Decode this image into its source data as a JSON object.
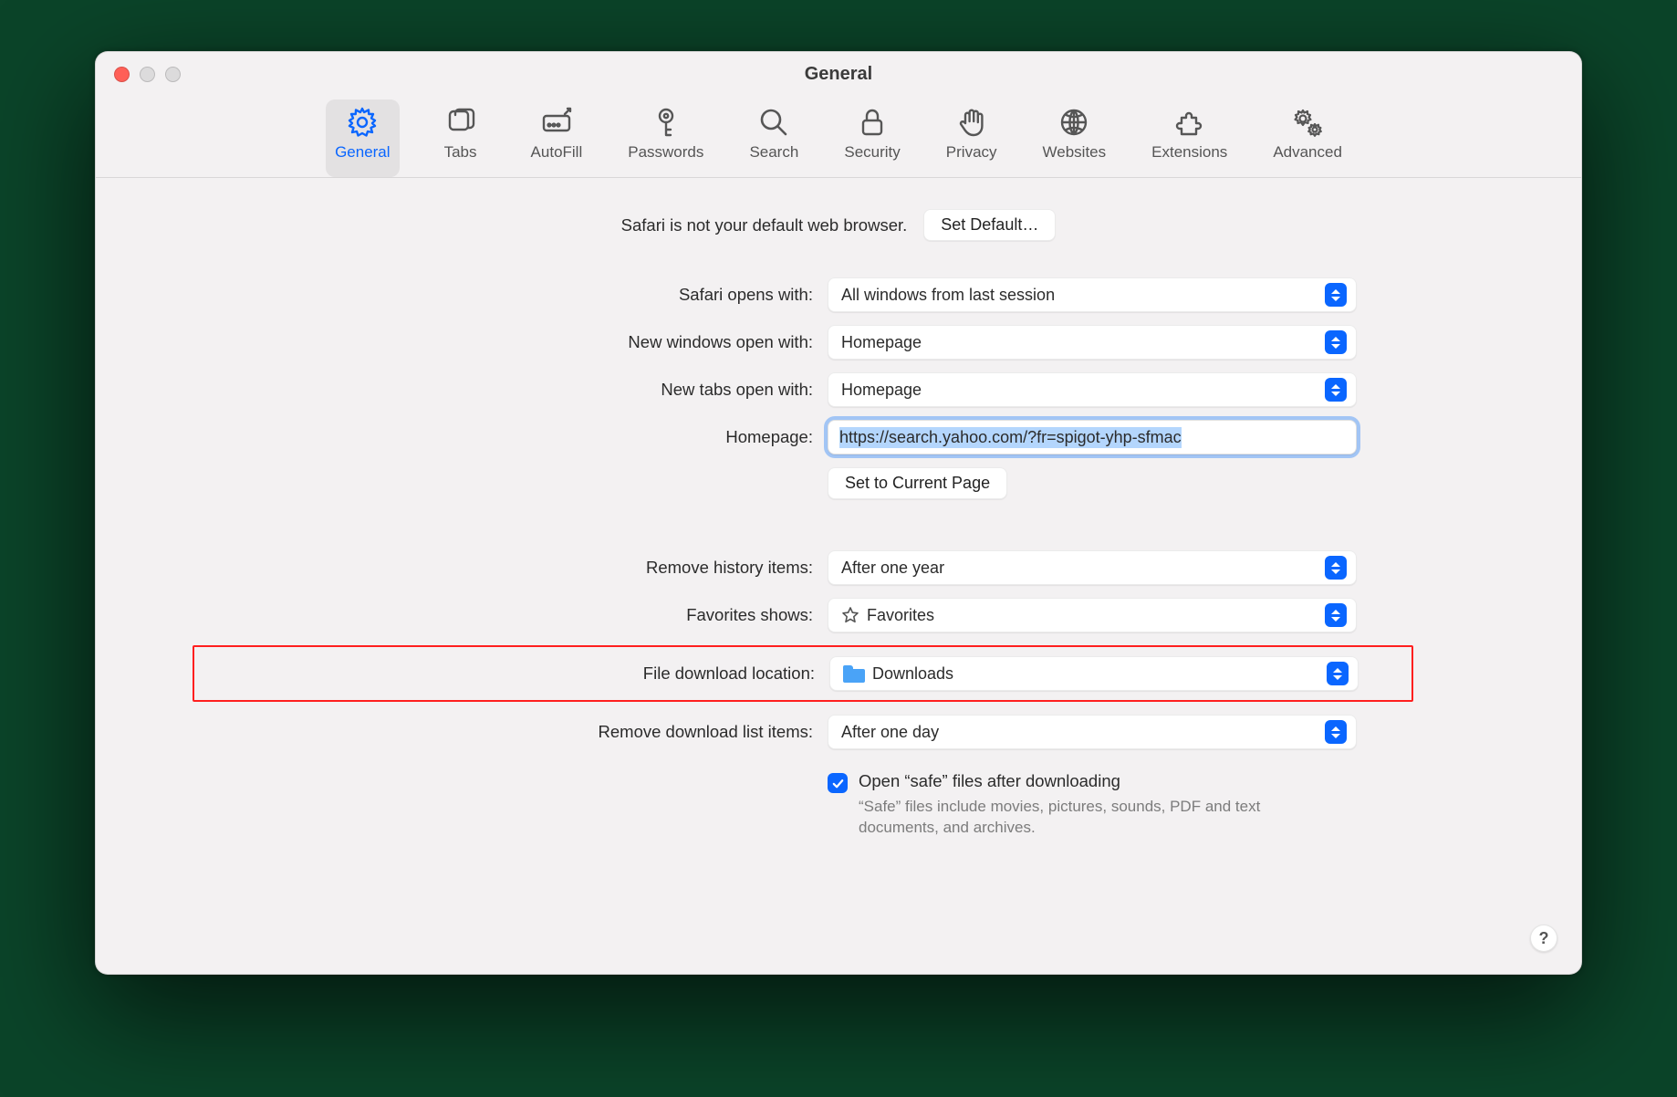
{
  "window": {
    "title": "General"
  },
  "toolbar": {
    "items": [
      {
        "label": "General"
      },
      {
        "label": "Tabs"
      },
      {
        "label": "AutoFill"
      },
      {
        "label": "Passwords"
      },
      {
        "label": "Search"
      },
      {
        "label": "Security"
      },
      {
        "label": "Privacy"
      },
      {
        "label": "Websites"
      },
      {
        "label": "Extensions"
      },
      {
        "label": "Advanced"
      }
    ]
  },
  "default_browser": {
    "message": "Safari is not your default web browser.",
    "button": "Set Default…"
  },
  "rows": {
    "opens_with": {
      "label": "Safari opens with:",
      "value": "All windows from last session"
    },
    "new_windows": {
      "label": "New windows open with:",
      "value": "Homepage"
    },
    "new_tabs": {
      "label": "New tabs open with:",
      "value": "Homepage"
    },
    "homepage": {
      "label": "Homepage:",
      "value": "https://search.yahoo.com/?fr=spigot-yhp-sfmac"
    },
    "set_current": "Set to Current Page",
    "remove_history": {
      "label": "Remove history items:",
      "value": "After one year"
    },
    "favorites": {
      "label": "Favorites shows:",
      "value": "Favorites"
    },
    "download_location": {
      "label": "File download location:",
      "value": "Downloads"
    },
    "remove_downloads": {
      "label": "Remove download list items:",
      "value": "After one day"
    },
    "open_safe": {
      "label": "Open “safe” files after downloading",
      "note": "“Safe” files include movies, pictures, sounds, PDF and text documents, and archives."
    }
  },
  "help": "?"
}
